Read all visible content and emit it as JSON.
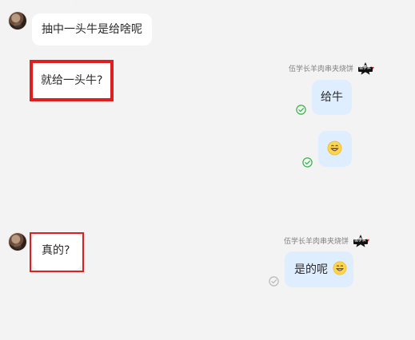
{
  "messages": [
    {
      "id": "msg-1",
      "text": "抽中一头牛是给啥呢"
    },
    {
      "id": "msg-2",
      "text": "就给一头牛?"
    },
    {
      "id": "msg-3",
      "sender": "伍学长羊肉串夹烧饼",
      "badge_text": "伍学长",
      "text": "给牛"
    },
    {
      "id": "msg-4",
      "emoji": "grinning-face"
    },
    {
      "id": "msg-5",
      "text": "真的?"
    },
    {
      "id": "msg-6",
      "sender": "伍学长羊肉串夹烧饼",
      "badge_text": "伍学长",
      "text": "是的呢"
    }
  ],
  "icons": {
    "avatar": "avatar",
    "status_read": "check-circle-icon",
    "status_sent": "check-circle-icon"
  },
  "colors": {
    "background": "#f3f3f3",
    "incoming_bubble": "#ffffff",
    "outgoing_bubble": "#dfeeff",
    "highlight": "#df1f1f",
    "status_green": "#35b34a",
    "status_gray": "#b8b8b8"
  }
}
